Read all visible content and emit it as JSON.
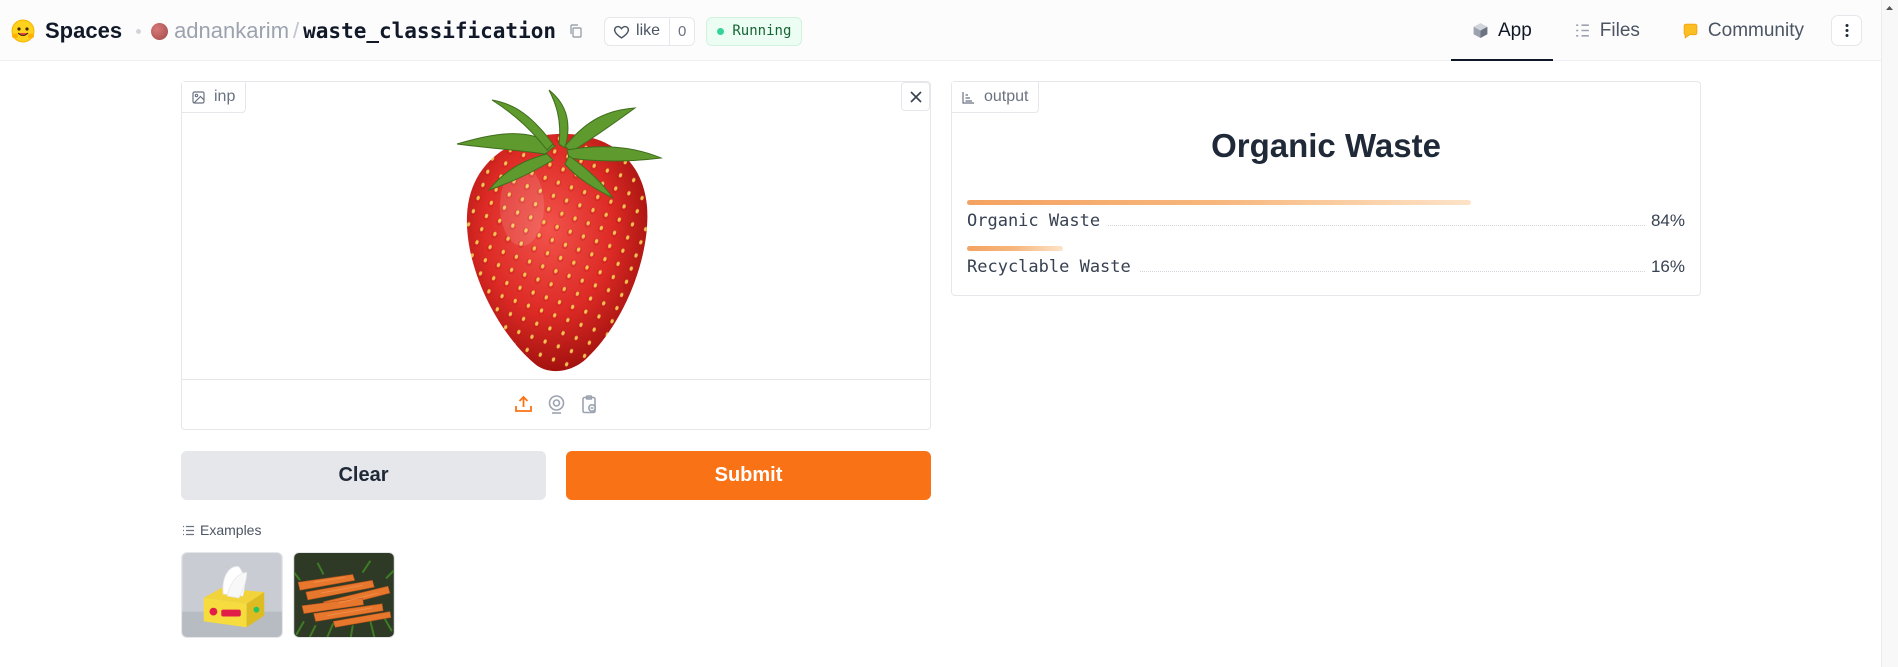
{
  "header": {
    "brand": "Spaces",
    "owner": "adnankarim",
    "separator": "/",
    "repo": "waste_classification",
    "like_label": "like",
    "like_count": "0",
    "status": "Running",
    "nav": [
      {
        "label": "App",
        "icon": "cube-icon",
        "active": true
      },
      {
        "label": "Files",
        "icon": "files-icon",
        "active": false
      },
      {
        "label": "Community",
        "icon": "community-icon",
        "active": false
      }
    ]
  },
  "input_panel": {
    "label": "inp",
    "image": "strawberry",
    "sources": [
      "upload-icon",
      "webcam-icon",
      "clipboard-icon"
    ]
  },
  "output_panel": {
    "label": "output",
    "predicted_label": "Organic Waste",
    "confidences": [
      {
        "label": "Organic Waste",
        "value": "84%",
        "fraction": 0.84
      },
      {
        "label": "Recyclable Waste",
        "value": "16%",
        "fraction": 0.16
      }
    ]
  },
  "buttons": {
    "clear": "Clear",
    "submit": "Submit"
  },
  "examples": {
    "label": "Examples",
    "items": [
      "tissue box",
      "carrots"
    ]
  },
  "colors": {
    "accent": "#f97316",
    "status_green": "#34d399",
    "bar_start": "#f4a261",
    "bar_end": "#fde3c8"
  }
}
